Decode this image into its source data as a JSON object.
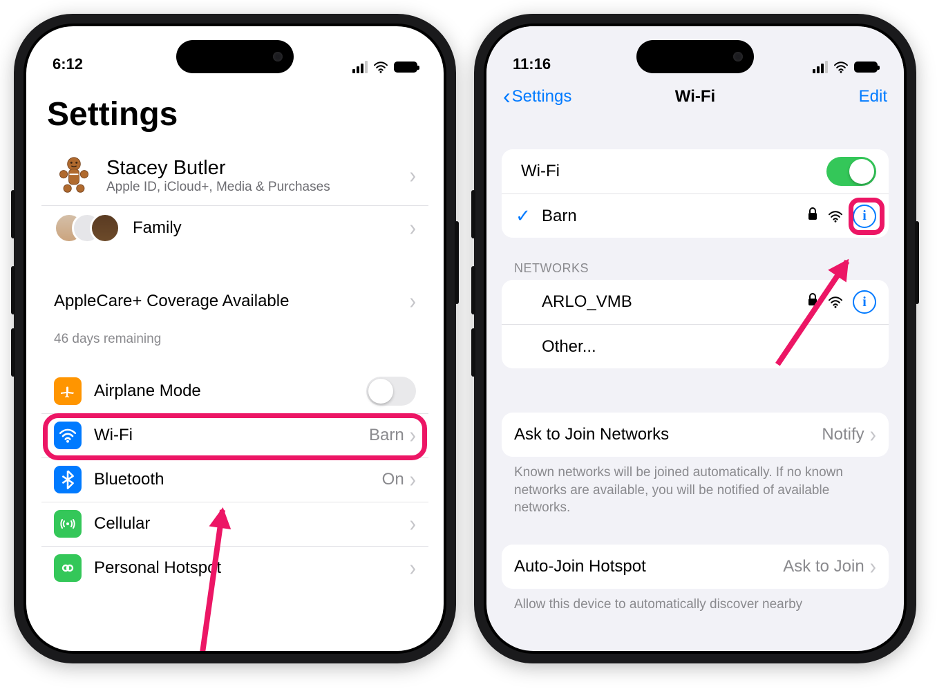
{
  "left": {
    "status_time": "6:12",
    "title": "Settings",
    "profile": {
      "name": "Stacey Butler",
      "subtitle": "Apple ID, iCloud+, Media & Purchases",
      "family_label": "Family"
    },
    "applecare": {
      "label": "AppleCare+ Coverage Available",
      "footer": "46 days remaining"
    },
    "rows": {
      "airplane": "Airplane Mode",
      "wifi": "Wi-Fi",
      "wifi_value": "Barn",
      "bluetooth": "Bluetooth",
      "bluetooth_value": "On",
      "cellular": "Cellular",
      "hotspot": "Personal Hotspot"
    }
  },
  "right": {
    "status_time": "11:16",
    "nav_back": "Settings",
    "nav_title": "Wi-Fi",
    "nav_edit": "Edit",
    "wifi_toggle_label": "Wi-Fi",
    "connected_network": "Barn",
    "networks_header": "Networks",
    "network1": "ARLO_VMB",
    "other": "Other...",
    "ask_join": {
      "label": "Ask to Join Networks",
      "value": "Notify",
      "footer": "Known networks will be joined automatically. If no known networks are available, you will be notified of available networks."
    },
    "auto_join": {
      "label": "Auto-Join Hotspot",
      "value": "Ask to Join",
      "footer": "Allow this device to automatically discover nearby"
    }
  },
  "colors": {
    "blue": "#007aff",
    "orange": "#ff9500",
    "green": "#34c759",
    "pink": "#ec1665"
  }
}
